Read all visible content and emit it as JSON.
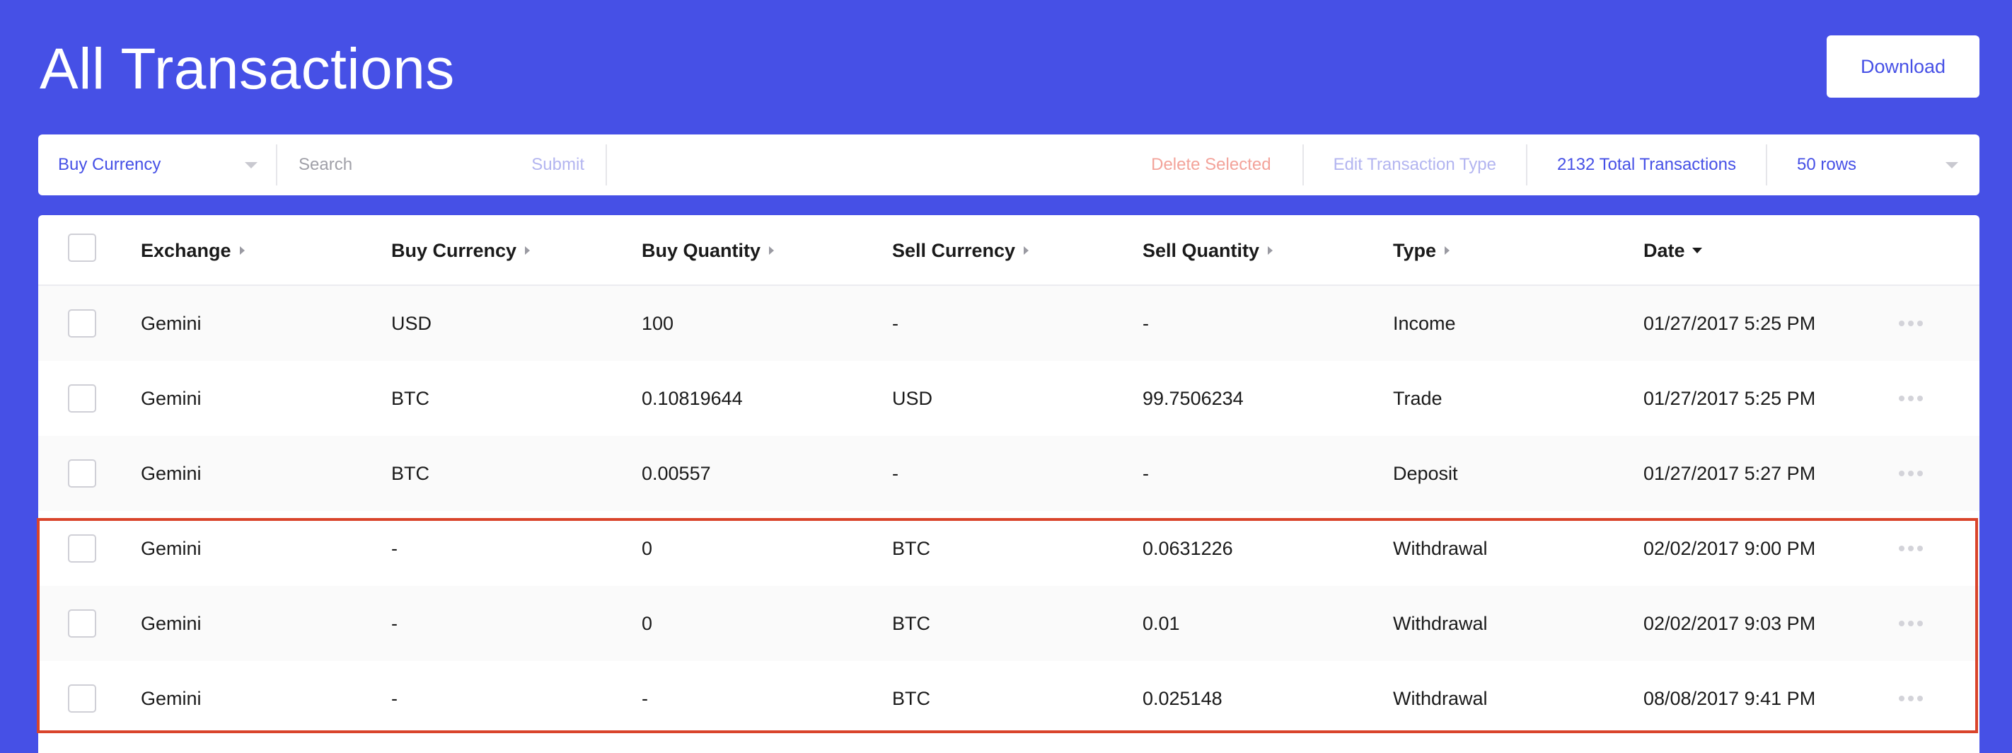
{
  "header": {
    "title": "All Transactions",
    "download_label": "Download"
  },
  "toolbar": {
    "filter_select": "Buy Currency",
    "search_placeholder": "Search",
    "submit_label": "Submit",
    "delete_label": "Delete Selected",
    "edit_type_label": "Edit Transaction Type",
    "total_label": "2132 Total Transactions",
    "rows_select": "50 rows"
  },
  "table": {
    "columns": [
      "Exchange",
      "Buy Currency",
      "Buy Quantity",
      "Sell Currency",
      "Sell Quantity",
      "Type",
      "Date"
    ],
    "rows": [
      {
        "exchange": "Gemini",
        "buy_currency": "USD",
        "buy_quantity": "100",
        "sell_currency": "-",
        "sell_quantity": "-",
        "type": "Income",
        "date": "01/27/2017 5:25 PM"
      },
      {
        "exchange": "Gemini",
        "buy_currency": "BTC",
        "buy_quantity": "0.10819644",
        "sell_currency": "USD",
        "sell_quantity": "99.7506234",
        "type": "Trade",
        "date": "01/27/2017 5:25 PM"
      },
      {
        "exchange": "Gemini",
        "buy_currency": "BTC",
        "buy_quantity": "0.00557",
        "sell_currency": "-",
        "sell_quantity": "-",
        "type": "Deposit",
        "date": "01/27/2017 5:27 PM"
      },
      {
        "exchange": "Gemini",
        "buy_currency": "-",
        "buy_quantity": "0",
        "sell_currency": "BTC",
        "sell_quantity": "0.0631226",
        "type": "Withdrawal",
        "date": "02/02/2017 9:00 PM"
      },
      {
        "exchange": "Gemini",
        "buy_currency": "-",
        "buy_quantity": "0",
        "sell_currency": "BTC",
        "sell_quantity": "0.01",
        "type": "Withdrawal",
        "date": "02/02/2017 9:03 PM"
      },
      {
        "exchange": "Gemini",
        "buy_currency": "-",
        "buy_quantity": "-",
        "sell_currency": "BTC",
        "sell_quantity": "0.025148",
        "type": "Withdrawal",
        "date": "08/08/2017 9:41 PM"
      }
    ]
  },
  "colors": {
    "background": "#4650e6",
    "accent": "#4650e6",
    "danger": "#f3a39a",
    "highlight": "#d9442b"
  }
}
